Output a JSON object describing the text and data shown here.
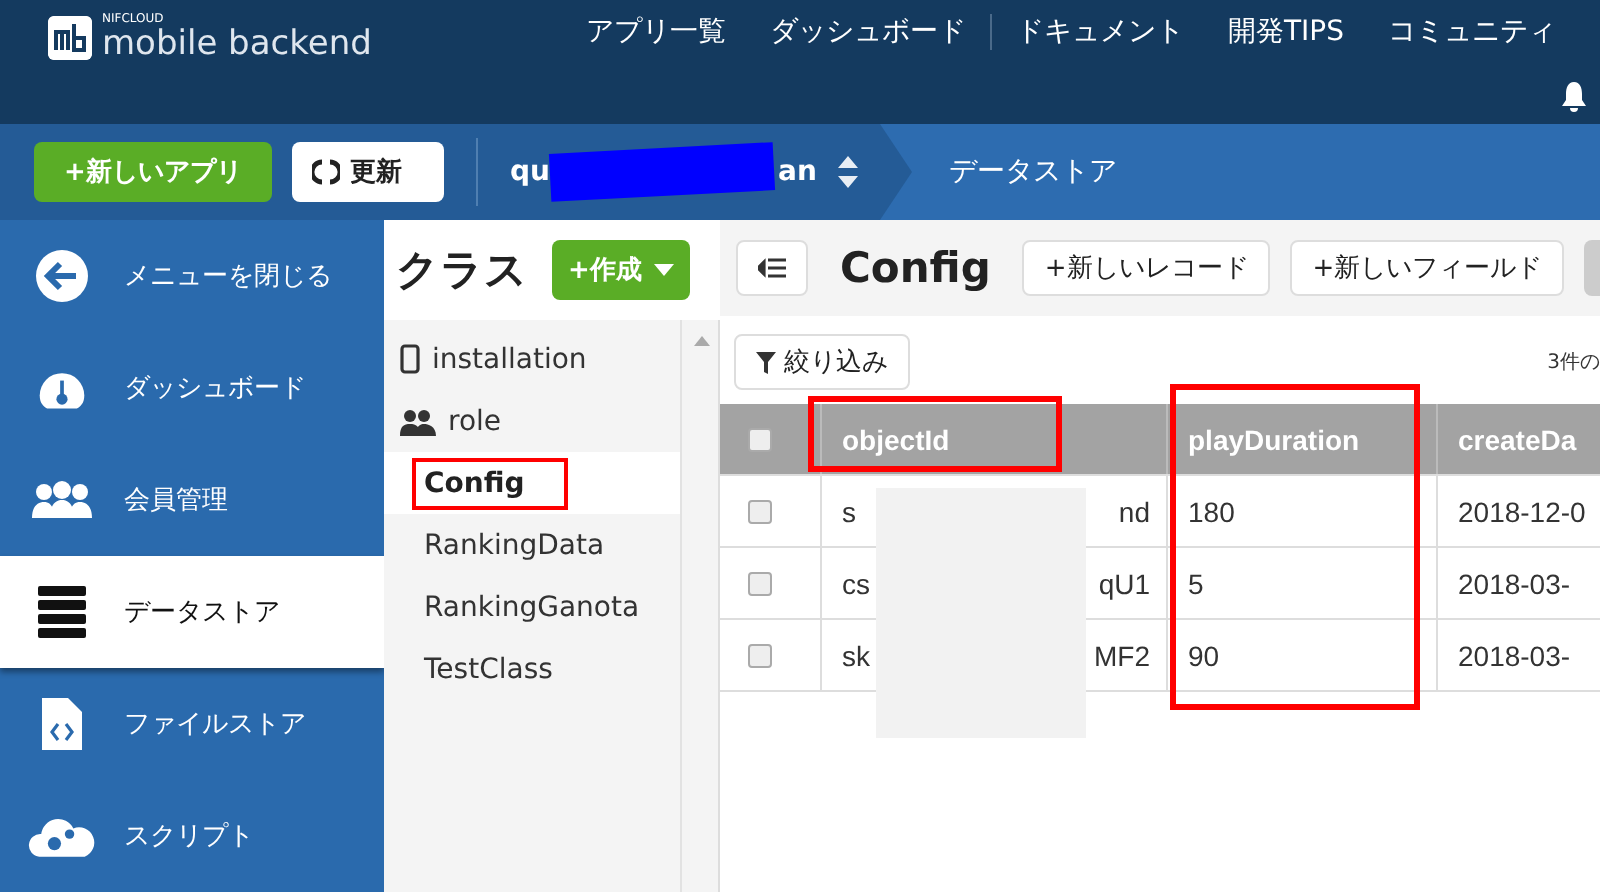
{
  "header": {
    "logo_small": "NIFCLOUD",
    "logo": "mobile backend",
    "nav_groups": [
      [
        "アプリ一覧",
        "ダッシュボード"
      ],
      [
        "ドキュメント",
        "開発TIPS",
        "コミュニティ"
      ]
    ]
  },
  "toolbar": {
    "new_app": "+新しいアプリ",
    "refresh": "更新",
    "app_name_start": "qu",
    "app_name_end": "an",
    "breadcrumb": "データストア"
  },
  "menu": [
    {
      "kind": "back",
      "label": "メニューを閉じる",
      "selected": false
    },
    {
      "kind": "gauge",
      "label": "ダッシュボード",
      "selected": false
    },
    {
      "kind": "people",
      "label": "会員管理",
      "selected": false
    },
    {
      "kind": "server",
      "label": "データストア",
      "selected": true
    },
    {
      "kind": "file",
      "label": "ファイルストア",
      "selected": false
    },
    {
      "kind": "cloud",
      "label": "スクリプト",
      "selected": false
    }
  ],
  "classes": {
    "title": "クラス",
    "create": "+作成",
    "items": [
      {
        "kind": "device",
        "name": "installation",
        "selected": false,
        "highlighted": false
      },
      {
        "kind": "role",
        "name": "role",
        "selected": false,
        "highlighted": false
      },
      {
        "kind": "plain",
        "name": "Config",
        "selected": true,
        "highlighted": true
      },
      {
        "kind": "plain",
        "name": "RankingData",
        "selected": false,
        "highlighted": false
      },
      {
        "kind": "plain",
        "name": "RankingGanota",
        "selected": false,
        "highlighted": false
      },
      {
        "kind": "plain",
        "name": "TestClass",
        "selected": false,
        "highlighted": false
      }
    ]
  },
  "data": {
    "title": "Config",
    "buttons": [
      "+新しいレコード",
      "+新しいフィールド"
    ],
    "filter": "絞り込み",
    "count": "3件の",
    "select_all": {
      "checked": false
    },
    "columns": [
      {
        "label": "objectId",
        "highlighted": true
      },
      {
        "label": "playDuration",
        "highlighted": true
      },
      {
        "label": "createDa",
        "highlighted": false
      }
    ],
    "rows": [
      {
        "checked": false,
        "cells": [
          {
            "start": "s",
            "end": "nd"
          },
          "180",
          "2018-12-0"
        ]
      },
      {
        "checked": false,
        "cells": [
          {
            "start": "cs",
            "end": "qU1"
          },
          "5",
          "2018-03-"
        ]
      },
      {
        "checked": false,
        "cells": [
          {
            "start": "sk",
            "end": "MF2"
          },
          "90",
          "2018-03-"
        ]
      }
    ]
  }
}
